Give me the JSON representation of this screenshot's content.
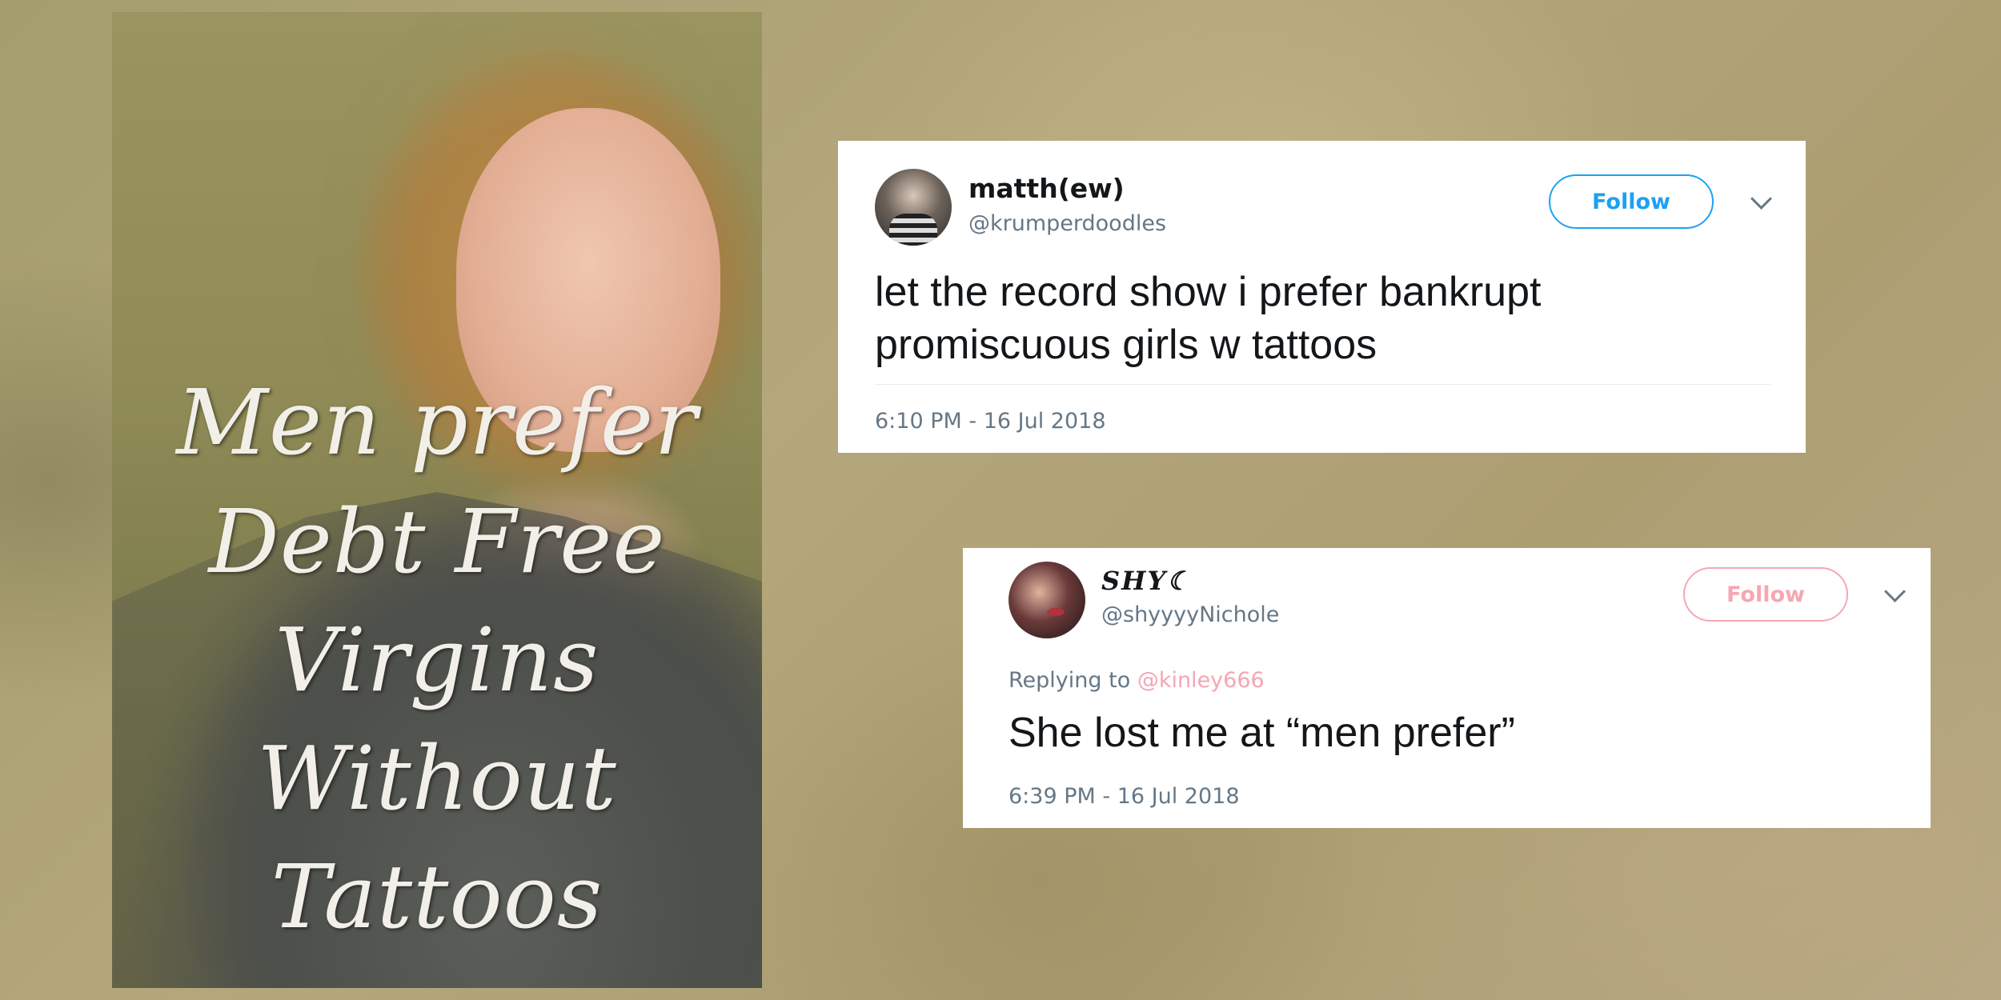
{
  "poster": {
    "lines": [
      "Men prefer",
      "Debt Free Virgins",
      "Without Tattoos"
    ]
  },
  "tweets": [
    {
      "name": "matth(ew)",
      "handle": "@krumperdoodles",
      "follow_label": "Follow",
      "text": "let the record show i prefer bankrupt promiscuous girls w tattoos",
      "timestamp": "6:10 PM - 16 Jul 2018",
      "accent_color": "#1da1f2"
    },
    {
      "name": "𝑺𝑯𝒀☾",
      "handle": "@shyyyyNichole",
      "follow_label": "Follow",
      "replying_prefix": "Replying to",
      "replying_to": "@kinley666",
      "text": "She lost me at “men prefer”",
      "timestamp": "6:39 PM - 16 Jul 2018",
      "accent_color": "#f4a7b2"
    }
  ],
  "icons": {
    "menu": "chevron-down-icon"
  }
}
